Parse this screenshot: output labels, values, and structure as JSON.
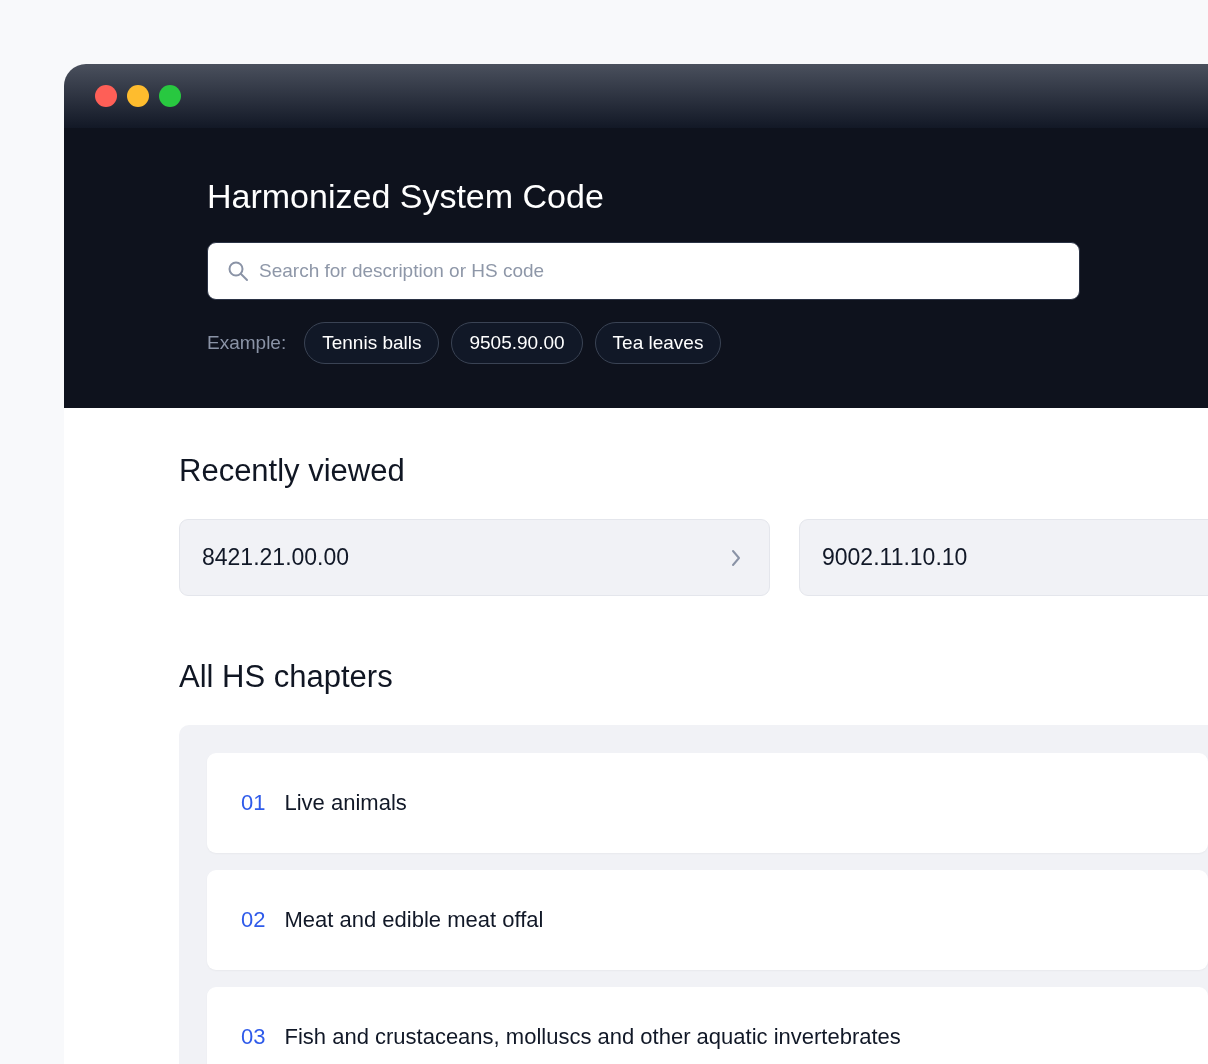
{
  "header": {
    "title": "Harmonized System Code",
    "search": {
      "placeholder": "Search for description or HS code"
    },
    "examples_label": "Example:",
    "examples": [
      "Tennis balls",
      "9505.90.00",
      "Tea leaves"
    ]
  },
  "recently_viewed": {
    "heading": "Recently viewed",
    "items": [
      {
        "code": "8421.21.00.00",
        "chevron": true
      },
      {
        "code": "9002.11.10.10"
      }
    ]
  },
  "chapters": {
    "heading": "All HS chapters",
    "items": [
      {
        "number": "01",
        "title": "Live animals"
      },
      {
        "number": "02",
        "title": "Meat and edible meat offal"
      },
      {
        "number": "03",
        "title": "Fish and crustaceans, molluscs and other aquatic invertebrates"
      }
    ]
  }
}
